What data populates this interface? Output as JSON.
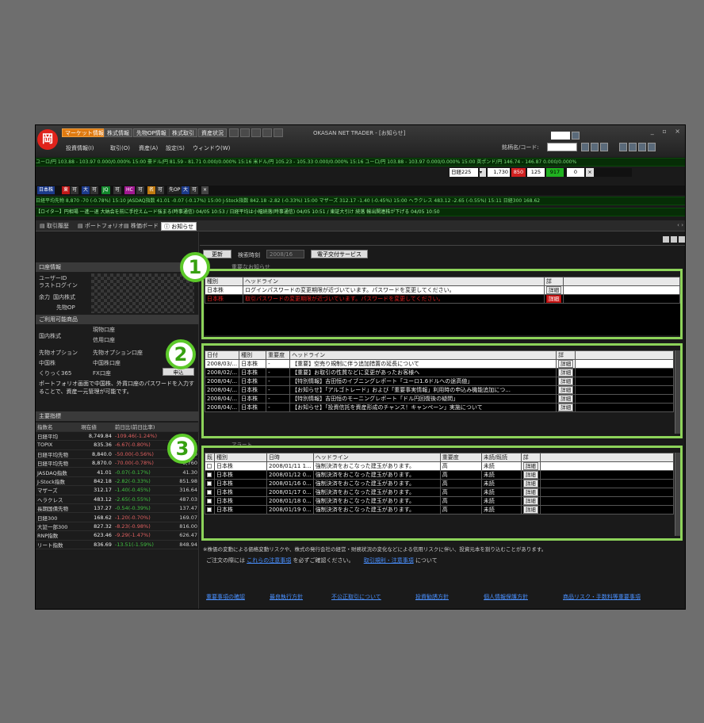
{
  "app": {
    "title": "OKASAN NET TRADER - [お知らせ]",
    "logo": "岡",
    "top_tabs": [
      "マーケット情報",
      "株式情報",
      "先物OP情報",
      "株式取引",
      "資産状況"
    ],
    "menu": [
      "投資情報(I)",
      "取引(O)",
      "資産(A)",
      "設定(S)",
      "ウィンドウ(W)"
    ],
    "search_label": "銘柄名/コード:",
    "window_controls": "_ ▫ ×"
  },
  "tickers": [
    "ユーロ/円 103.88 - 103.97 0.000/0.000% 15:00   豪ドル/円 81.59 - 81.71 0.000/0.000% 15:16   米ドル/円 105.23 - 105.33 0.000/0.000% 15:16   ユーロ/円 103.88 - 103.97 0.000/0.000% 15:00   英ポンド/円 146.74 - 146.87 0.000/0.000%",
    "日経平均先物 8,870 -70 (-0.78%) 15:10   JASDAQ指数 41.01 -0.07 (-0.17%) 15:00   J-Stock指数 842.18 -2.82 (-0.33%) 15:00   マザーズ 312.17 -1.40 (-0.45%) 15:00   ヘラクレス 483.12 -2.65 (-0.55%) 15:11   日経300 168.62",
    "【ロイター】円相場 一進一退 大納会を前に手控えムード強まる(時事通信) 04/05 10:53 / 日経平均は小幅続落(時事通信) 04/05 10:51 / 東証大引け 続落 輸出関連株が下げる 04/05 10:50"
  ],
  "index_row": [
    {
      "label": "日本株",
      "bg": "#1c3a8a"
    },
    {
      "label": "東",
      "bg": "#c01818"
    },
    {
      "label": "可",
      "bg": "#333"
    },
    {
      "label": "大",
      "bg": "#1c3a8a"
    },
    {
      "label": "可",
      "bg": "#333"
    },
    {
      "label": "JQ",
      "bg": "#10862a"
    },
    {
      "label": "可",
      "bg": "#333"
    },
    {
      "label": "HC",
      "bg": "#a01890"
    },
    {
      "label": "可",
      "bg": "#333"
    },
    {
      "label": "名",
      "bg": "#c07a10"
    },
    {
      "label": "可",
      "bg": "#333"
    },
    {
      "label": "先OP",
      "bg": "#222"
    },
    {
      "label": "大",
      "bg": "#1c3a8a"
    },
    {
      "label": "可",
      "bg": "#333"
    },
    {
      "label": "×",
      "bg": "#444"
    }
  ],
  "price_box": {
    "label": "日経225",
    "v1": "1,730",
    "v2": "850",
    "v3": "125",
    "v4": "917",
    "v5": "0"
  },
  "doc_tabs": [
    "取引履歴",
    "ポートフォリオ",
    "株価ボード",
    "お知らせ"
  ],
  "left": {
    "account_header": "口座情報",
    "user_id_label": "ユーザーID",
    "last_login_label": "ラストログイン",
    "buying_power_label": "余力",
    "domestic_label": "国内株式",
    "futures_label": "先物OP",
    "services_header": "ご利用可能商品",
    "services": [
      {
        "name": "国内株式",
        "items": [
          "現物口座",
          "信用口座"
        ]
      },
      {
        "name": "先物オプション",
        "items": [
          "先物オプション口座"
        ]
      },
      {
        "name": "中国株",
        "items": [
          "中国株口座"
        ]
      },
      {
        "name": "くりっく365",
        "items": [
          "FX口座"
        ]
      }
    ],
    "apply_button": "申込",
    "note": "ポートフォリオ画面で中国株、外貨口座のパスワードを入力することで、資産一元管理が可能です。",
    "index_header": "主要指標",
    "index_columns": [
      "指数名",
      "現在値",
      "前日比(前日比率)",
      ""
    ],
    "indices": [
      {
        "name": "日経平均",
        "value": "8,749.84",
        "change": "-109.46(-1.24%)",
        "extra": "",
        "dir": "up"
      },
      {
        "name": "TOPIX",
        "value": "835.36",
        "change": "-6.67(-0.80%)",
        "extra": "",
        "dir": "up"
      },
      {
        "name": "日経平均先物",
        "value": "8,840.0",
        "change": "-50.00(-0.56%)",
        "extra": "8,840",
        "dir": "up"
      },
      {
        "name": "日経平均先物",
        "value": "8,870.0",
        "change": "-70.00(-0.78%)",
        "extra": "8,760",
        "dir": "up"
      },
      {
        "name": "JASDAQ指数",
        "value": "41.01",
        "change": "-0.07(-0.17%)",
        "extra": "41.30",
        "dir": "dn"
      },
      {
        "name": "J-Stock指数",
        "value": "842.18",
        "change": "-2.82(-0.33%)",
        "extra": "851.98",
        "dir": "dn"
      },
      {
        "name": "マザーズ",
        "value": "312.17",
        "change": "-1.40(-0.45%)",
        "extra": "316.64",
        "dir": "dn"
      },
      {
        "name": "ヘラクレス",
        "value": "483.12",
        "change": "-2.65(-0.55%)",
        "extra": "487.03",
        "dir": "dn"
      },
      {
        "name": "長期国債先物",
        "value": "137.27",
        "change": "-0.54(-0.39%)",
        "extra": "137.47",
        "dir": "dn"
      },
      {
        "name": "日経300",
        "value": "168.62",
        "change": "-1.20(-0.70%)",
        "extra": "169.07",
        "dir": "up"
      },
      {
        "name": "大証一部300",
        "value": "827.32",
        "change": "-8.23(-0.98%)",
        "extra": "816.00",
        "dir": "up"
      },
      {
        "name": "RNP指数",
        "value": "623.46",
        "change": "-9.29(-1.47%)",
        "extra": "626.47",
        "dir": "up"
      },
      {
        "name": "リート指数",
        "value": "836.69",
        "change": "-13.51(-1.59%)",
        "extra": "848.94",
        "dir": "dn"
      }
    ]
  },
  "main": {
    "update_button": "更新",
    "search_date_label": "検索時刻",
    "search_date_value": "2008/16",
    "e_delivery_button": "電子交付サービス",
    "important_header": "重要なお知らせ",
    "important_columns": [
      "種別",
      "ヘッドライン",
      "詳"
    ],
    "important": [
      {
        "type": "日本株",
        "headline": "ログインパスワードの変更期限が近づいています。パスワードを変更してください。",
        "btn": "詳細",
        "style": "W"
      },
      {
        "type": "日本株",
        "headline": "取引パスワードの変更期限が近づいています。パスワードを変更してください。",
        "btn": "詳細",
        "style": "Red"
      }
    ],
    "news_columns": [
      "日付",
      "種別",
      "重要度",
      "ヘッドライン",
      "詳"
    ],
    "news": [
      {
        "date": "2008/03/...",
        "type": "日本株",
        "level": "-",
        "headline": "【重要】空売り規制に伴う追加措置の延長について",
        "btn": "詳細",
        "style": "W"
      },
      {
        "date": "2008/02/...",
        "type": "日本株",
        "level": "-",
        "headline": "【重要】お取引の性質などに変更があったお客様へ",
        "btn": "詳細",
        "style": "B"
      },
      {
        "date": "2008/04/...",
        "type": "日本株",
        "level": "-",
        "headline": "【特別情報】吉田恒のイブニングレポート「ユーロ1.6ドルへの途高値」",
        "btn": "詳細",
        "style": "B"
      },
      {
        "date": "2008/04/...",
        "type": "日本株",
        "level": "-",
        "headline": "【お知らせ】「アルゴトレード」および「重要事実情報」利用時の申込み機能追加につ...",
        "btn": "詳細",
        "style": "B"
      },
      {
        "date": "2008/04/...",
        "type": "日本株",
        "level": "-",
        "headline": "【特別情報】吉田恒のモーニングレポート「ドル円回復後の疑問」",
        "btn": "詳細",
        "style": "B"
      },
      {
        "date": "2008/04/...",
        "type": "日本株",
        "level": "-",
        "headline": "【お知らせ】「投資信託を資産形成のチャンス！キャンペーン」実施について",
        "btn": "詳細",
        "style": "B"
      }
    ],
    "alert_header": "アラート",
    "alert_columns": [
      "既",
      "種別",
      "日時",
      "ヘッドライン",
      "重要度",
      "未読/既読",
      "詳"
    ],
    "alerts": [
      {
        "type": "日本株",
        "datetime": "2008/01/11 1...",
        "headline": "強制決済をおこなった建玉があります。",
        "level": "高",
        "status": "未読",
        "btn": "詳細",
        "style": "W"
      },
      {
        "type": "日本株",
        "datetime": "2008/01/12 0...",
        "headline": "強制決済をおこなった建玉があります。",
        "level": "高",
        "status": "未読",
        "btn": "詳細",
        "style": "B"
      },
      {
        "type": "日本株",
        "datetime": "2008/01/16 0...",
        "headline": "強制決済をおこなった建玉があります。",
        "level": "高",
        "status": "未読",
        "btn": "詳細",
        "style": "B"
      },
      {
        "type": "日本株",
        "datetime": "2008/01/17 0...",
        "headline": "強制決済をおこなった建玉があります。",
        "level": "高",
        "status": "未読",
        "btn": "詳細",
        "style": "B"
      },
      {
        "type": "日本株",
        "datetime": "2008/01/18 0...",
        "headline": "強制決済をおこなった建玉があります。",
        "level": "高",
        "status": "未読",
        "btn": "詳細",
        "style": "B"
      },
      {
        "type": "日本株",
        "datetime": "2008/01/19 0...",
        "headline": "強制決済をおこなった建玉があります。",
        "level": "高",
        "status": "未読",
        "btn": "詳細",
        "style": "B"
      }
    ],
    "disclaimer": "※株価の変動による価格変動リスクや、株式の発行会社の経営・財務状況の変化などによる信用リスクに伴い、投資元本を割り込むことがあります。",
    "notice_prefix": "ご注文の際には",
    "notice_link1": "これらの注意事項",
    "notice_mid": "を必ずご確認ください。",
    "notice_link2": "取引規則・注意事項",
    "notice_suffix": "について",
    "footer_links": [
      "重要事項の確認",
      "最良執行方針",
      "不公正取引について",
      "投資勧誘方針",
      "個人情報保護方針",
      "商品リスク・手数料等重要事項"
    ]
  },
  "callouts": [
    "1",
    "2",
    "3"
  ]
}
